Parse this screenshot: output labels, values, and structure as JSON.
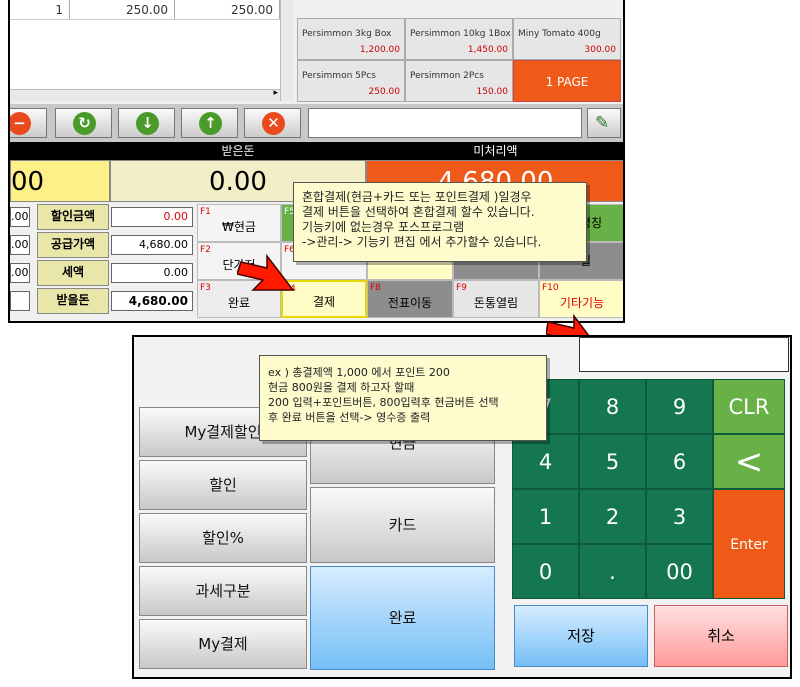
{
  "pos": {
    "grid_row": {
      "c1": "1",
      "c2": "250.00",
      "c3": "250.00"
    },
    "products": [
      {
        "name": "Persimmon 3kg Box",
        "price": "1,200.00"
      },
      {
        "name": "Persimmon 10kg 1Box",
        "price": "1,450.00"
      },
      {
        "name": "Miny Tomato 400g",
        "price": "300.00"
      },
      {
        "name": "Persimmon 5Pcs",
        "price": "250.00"
      },
      {
        "name": "Persimmon 2Pcs",
        "price": "150.00"
      }
    ],
    "page_btn": "1 PAGE",
    "received_header": "받은돈",
    "received_value": "0.00",
    "unpaid_header": "미처리액",
    "unpaid_value": "4,680.00",
    "total_partial": "00",
    "summary": [
      {
        "label": "할인금액",
        "value": "0.00"
      },
      {
        "label": "공급가액",
        "value": "4,680.00"
      },
      {
        "label": "세액",
        "value": "0.00"
      },
      {
        "label": "받을돈",
        "value": "4,680.00"
      }
    ],
    "left_partials": [
      ".00",
      ".00",
      ".00"
    ],
    "fkeys": {
      "f1": {
        "key": "F1",
        "label": "₩현금"
      },
      "f2": {
        "key": "F2",
        "label": "단가저"
      },
      "f3": {
        "key": "F3",
        "label": "완료"
      },
      "f4": {
        "key": "F4",
        "label": "결제"
      },
      "f5": {
        "key": "F5"
      },
      "f6": {
        "key": "F6"
      },
      "f8": {
        "key": "F8",
        "label": "전표이동"
      },
      "f9": {
        "key": "F9",
        "label": "돈통열림"
      },
      "f10": {
        "key": "F10",
        "label": "기타기능"
      },
      "r1": "명칭",
      "r2": "실"
    },
    "tooltip": [
      "혼합결제(현금+카드 또는 포인트결제 )일경우",
      "결제 버튼을 선택하여 혼합결제 할수 있습니다.",
      "기능키에 없는경우 포스프로그램",
      " ->관리-> 기능키 편집 에서 추가할수 있습니다."
    ]
  },
  "pay": {
    "left_buttons": [
      "My결제할인",
      "할인",
      "할인%",
      "과세구분",
      "My결제"
    ],
    "mid_buttons": [
      "현금",
      "카드",
      "완료"
    ],
    "keypad": [
      "7",
      "8",
      "9",
      "CLR",
      "4",
      "5",
      "6",
      "<",
      "1",
      "2",
      "3",
      "Enter",
      "0",
      ".",
      "00"
    ],
    "save": "저장",
    "cancel": "취소",
    "tooltip": [
      "ex ) 총결제액 1,000 에서 포인트 200",
      "현금 800원을 결제 하고자 할때",
      "200 입력+포인트버튼, 800입력후 현금버튼 선택",
      "후 완료 버튼을 선택-> 영수증 출력"
    ]
  },
  "colors": {
    "accent_orange": "#f05a19",
    "keypad_green": "#14774f",
    "light_green": "#67b147",
    "red_arrow": "#ff1a00"
  }
}
